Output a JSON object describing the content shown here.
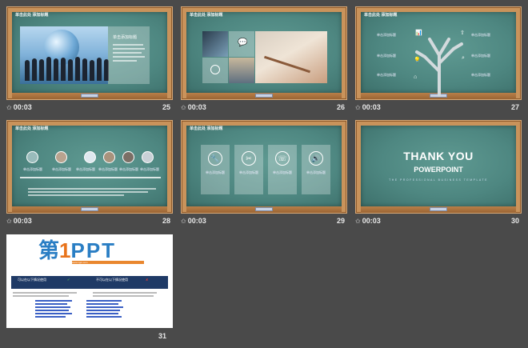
{
  "slides": [
    {
      "number": "25",
      "time": "00:03",
      "title": "单击此处  添加标题",
      "heading": "单击添加标题"
    },
    {
      "number": "26",
      "time": "00:03",
      "title": "单击此处  添加标题"
    },
    {
      "number": "27",
      "time": "00:03",
      "title": "单击此处  添加标题",
      "labels": [
        "单击添加标题",
        "单击添加标题",
        "单击添加标题",
        "单击添加标题",
        "单击添加标题",
        "单击添加标题"
      ]
    },
    {
      "number": "28",
      "time": "00:03",
      "title": "单击此处  添加标题",
      "labels": [
        "单击添加标题",
        "单击添加标题",
        "单击添加标题",
        "单击添加标题",
        "单击添加标题",
        "单击添加标题"
      ]
    },
    {
      "number": "29",
      "time": "00:03",
      "title": "单击此处  添加标题",
      "labels": [
        "单击添加标题",
        "单击添加标题",
        "单击添加标题",
        "单击添加标题"
      ]
    },
    {
      "number": "30",
      "time": "00:03",
      "thank_you": "THANK YOU",
      "powerpoint": "POWERPOINT",
      "tagline": "THE PROFESSIONAL BUSINESS TEMPLATE"
    },
    {
      "number": "31",
      "logo_di": "第",
      "logo_one": "1",
      "logo_ppt": "PPT",
      "url": "www.1ppt.com",
      "left_band": "可以在以下情况使用",
      "right_band": "不可以在以下情况使用"
    }
  ],
  "colors": {
    "background": "#4a4a4a",
    "frame": "#c9935b",
    "board": "#4e8781",
    "accent_blue": "#2a7ec4",
    "accent_orange": "#e8731b"
  }
}
